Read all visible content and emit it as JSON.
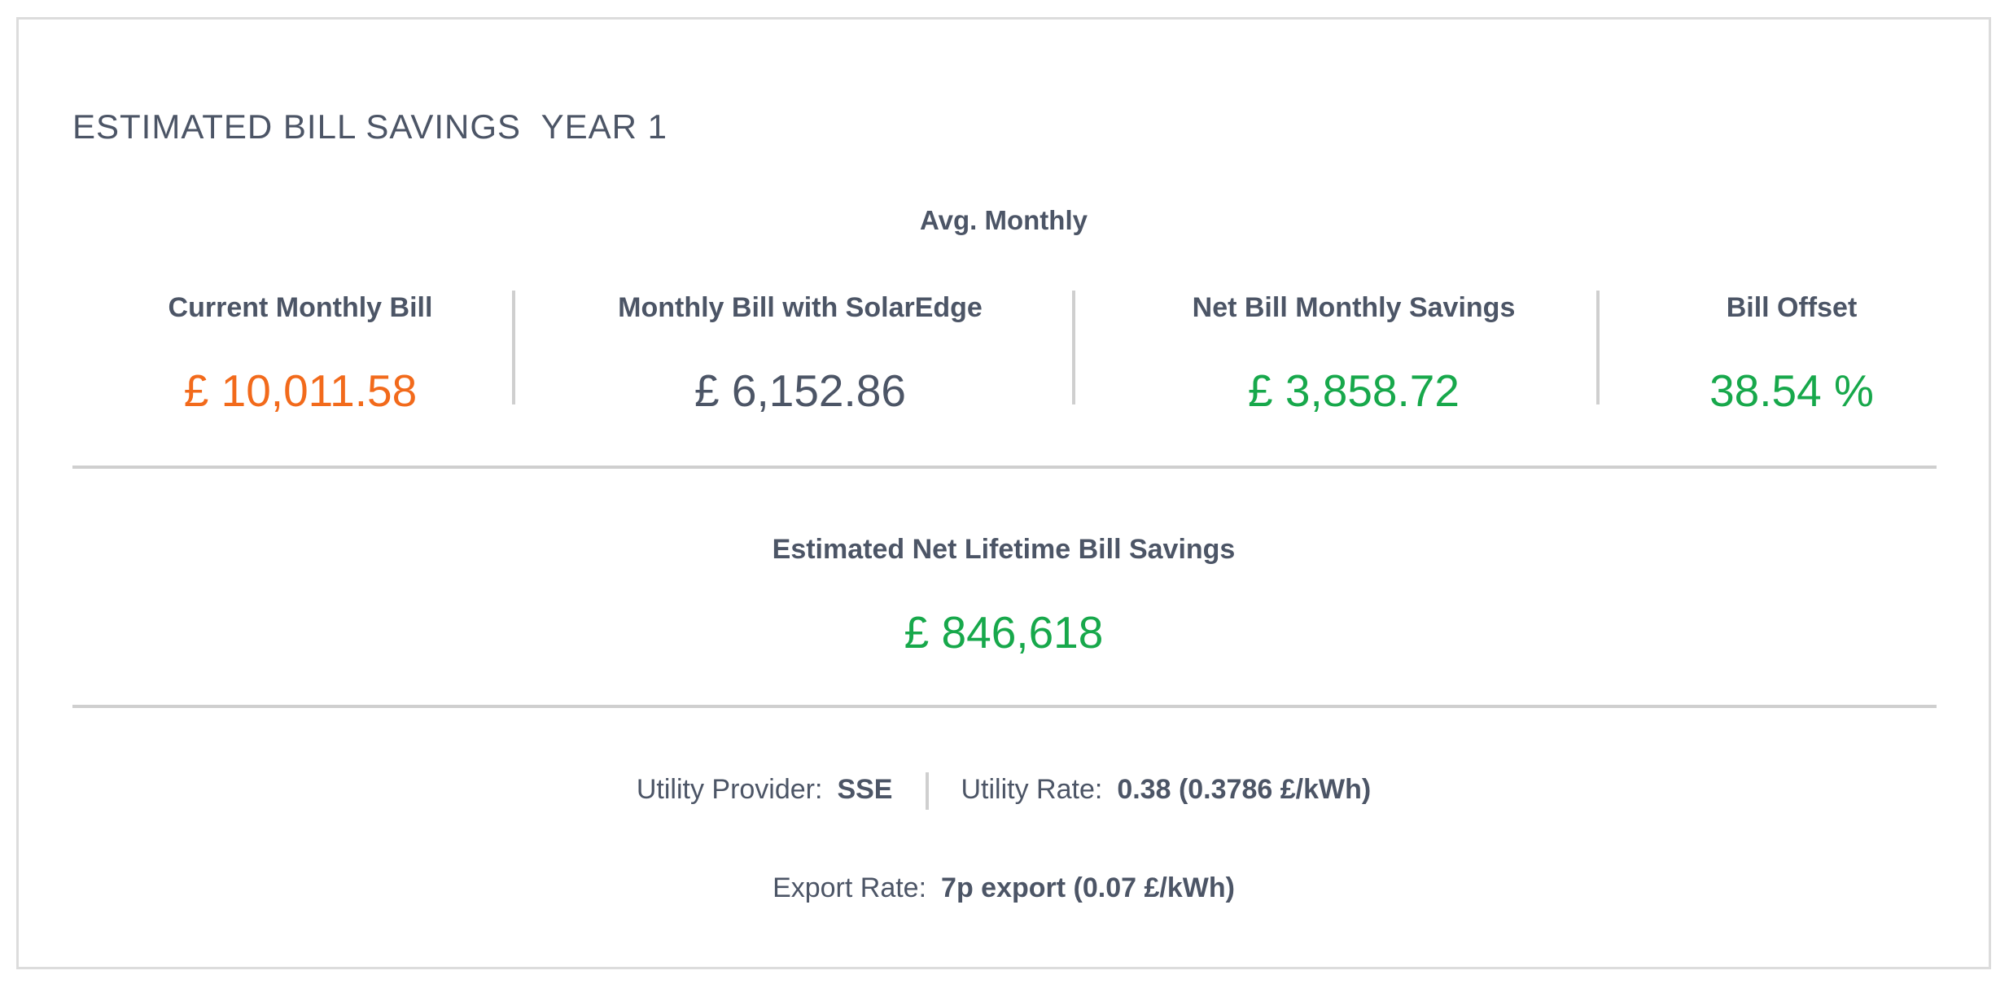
{
  "card": {
    "title": "ESTIMATED BILL SAVINGS  YEAR 1",
    "avg_label": "Avg. Monthly"
  },
  "metrics": [
    {
      "label": "Current Monthly Bill",
      "value": "£ 10,011.58",
      "color": "#f26a1b"
    },
    {
      "label": "Monthly Bill with SolarEdge",
      "value": "£ 6,152.86",
      "color": "#4c5566"
    },
    {
      "label": "Net Bill Monthly Savings",
      "value": "£ 3,858.72",
      "color": "#17a84b"
    },
    {
      "label": "Bill Offset",
      "value": "38.54 %",
      "color": "#17a84b"
    }
  ],
  "lifetime": {
    "label": "Estimated Net Lifetime Bill Savings",
    "value": "£ 846,618",
    "color": "#17a84b"
  },
  "info": {
    "utility_provider_label": "Utility Provider:",
    "utility_provider_value": "SSE",
    "utility_rate_label": "Utility Rate:",
    "utility_rate_value": "0.38 (0.3786 £/kWh)",
    "export_rate_label": "Export Rate:",
    "export_rate_value": "7p export (0.07 £/kWh)"
  }
}
